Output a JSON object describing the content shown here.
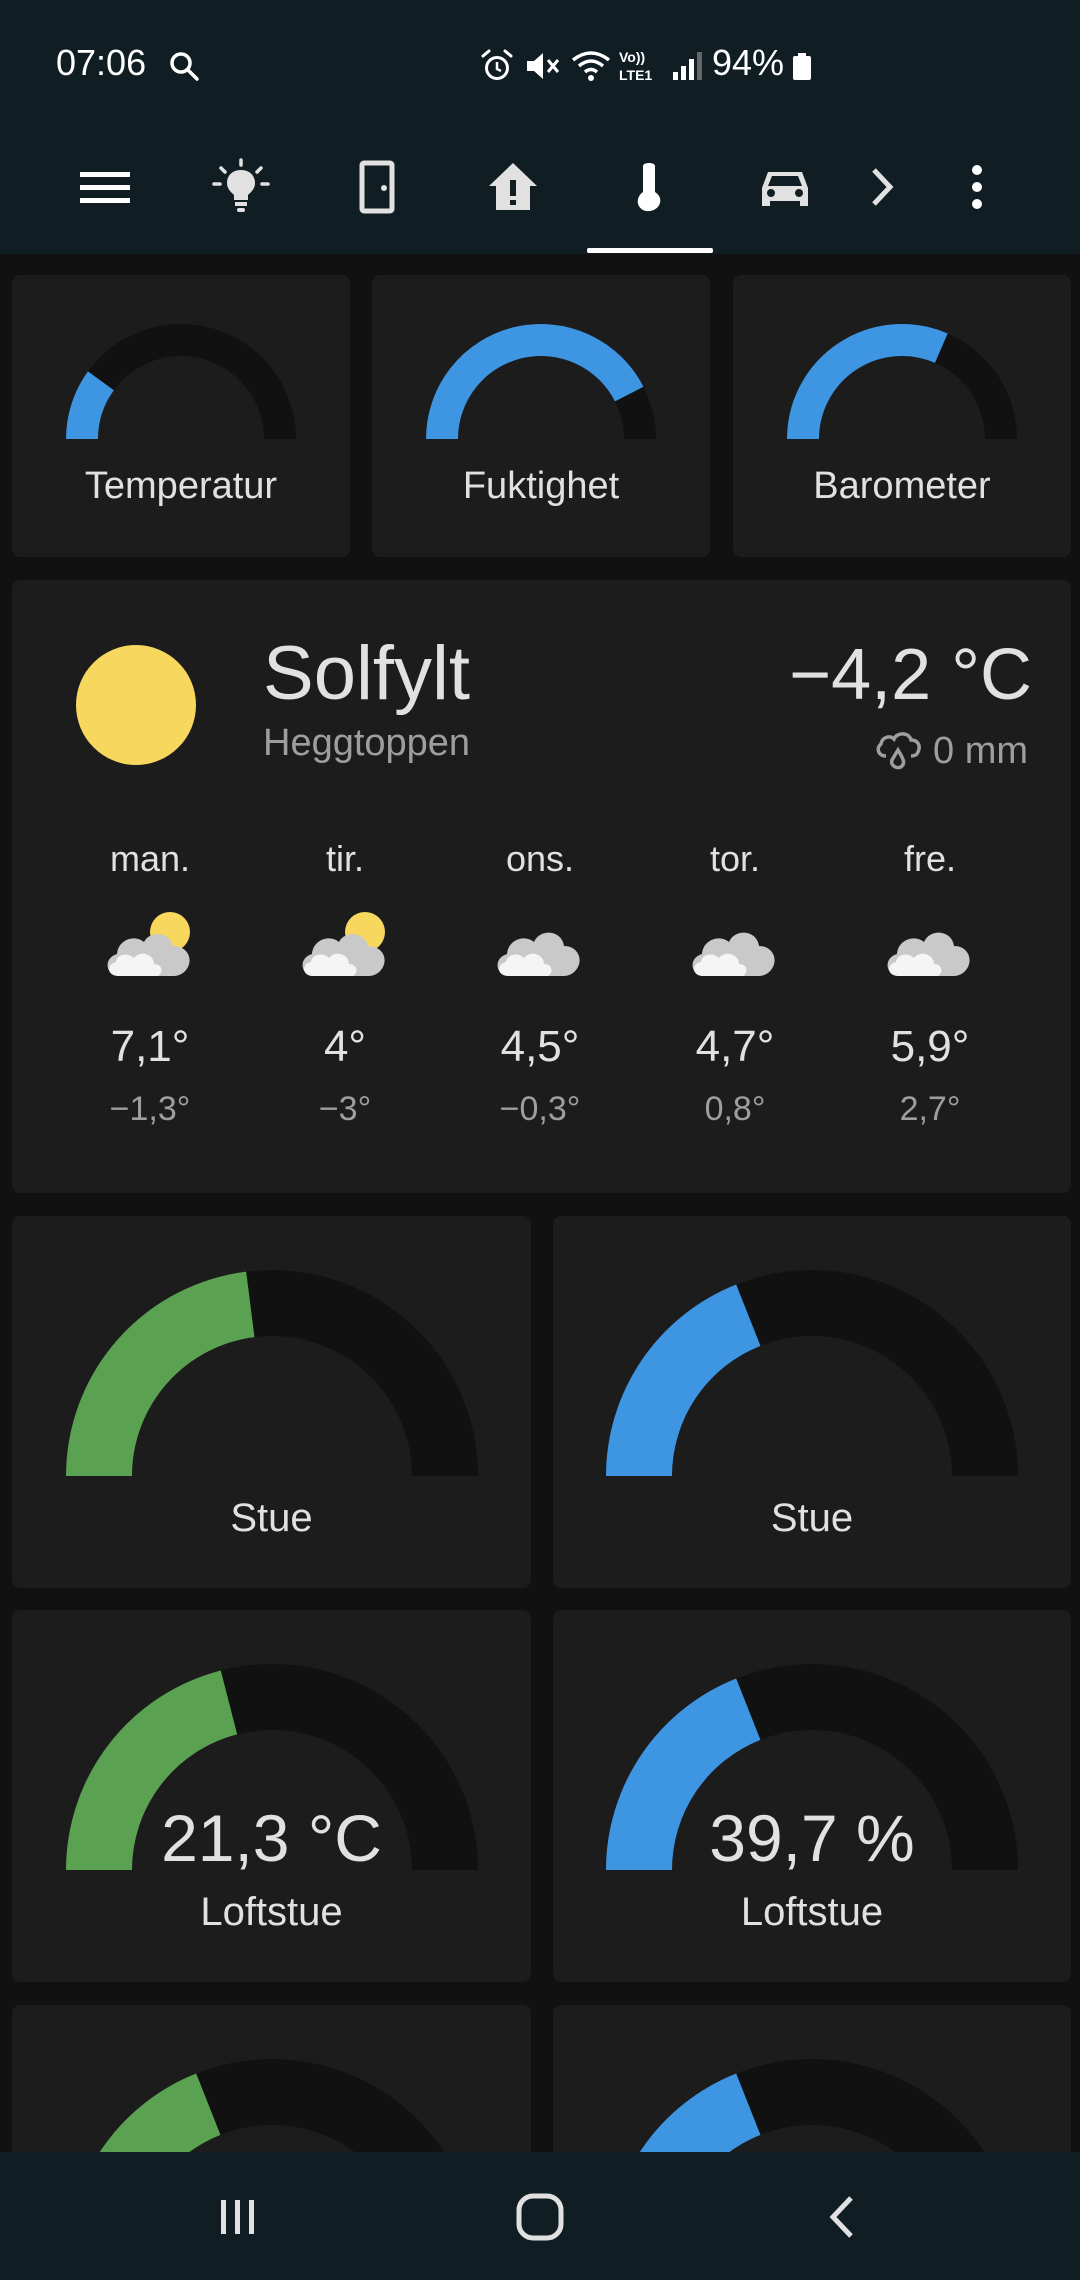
{
  "status_bar": {
    "time": "07:06",
    "battery": "94%",
    "icons": [
      "search-icon",
      "alarm-icon",
      "mute-icon",
      "wifi-calling-icon",
      "volte-icon",
      "signal-icon",
      "battery-icon"
    ]
  },
  "tabs": [
    {
      "name": "menu-icon"
    },
    {
      "name": "lightbulb-icon"
    },
    {
      "name": "door-icon"
    },
    {
      "name": "home-alert-icon"
    },
    {
      "name": "thermometer-icon",
      "active": true
    },
    {
      "name": "car-icon"
    },
    {
      "name": "chevron-right-icon"
    },
    {
      "name": "more-vertical-icon"
    }
  ],
  "colors": {
    "accent_blue": "#3e95e2",
    "green": "#5aa152",
    "track": "#111111",
    "card": "#1c1c1c",
    "sun": "#f7d75e"
  },
  "top_gauges": [
    {
      "title": "Temperatur",
      "fraction": 0.2,
      "color": "#3e95e2"
    },
    {
      "title": "Fuktighet",
      "fraction": 0.85,
      "color": "#3e95e2"
    },
    {
      "title": "Barometer",
      "fraction": 0.63,
      "color": "#3e95e2"
    }
  ],
  "weather": {
    "condition": "Solfylt",
    "location": "Heggtoppen",
    "temperature": "−4,2 °C",
    "precipitation": "0 mm",
    "forecast": [
      {
        "day": "man.",
        "high": "7,1°",
        "low": "−1,3°",
        "icon": "partly-cloudy-icon"
      },
      {
        "day": "tir.",
        "high": "4°",
        "low": "−3°",
        "icon": "partly-cloudy-icon"
      },
      {
        "day": "ons.",
        "high": "4,5°",
        "low": "−0,3°",
        "icon": "cloudy-icon"
      },
      {
        "day": "tor.",
        "high": "4,7°",
        "low": "0,8°",
        "icon": "cloudy-icon"
      },
      {
        "day": "fre.",
        "high": "5,9°",
        "low": "2,7°",
        "icon": "cloudy-icon"
      }
    ]
  },
  "room_gauges": [
    {
      "title": "Stue",
      "value": "",
      "fraction": 0.46,
      "color": "#5aa152"
    },
    {
      "title": "Stue",
      "value": "",
      "fraction": 0.38,
      "color": "#3e95e2"
    },
    {
      "title": "Loftstue",
      "value": "21,3 °C",
      "fraction": 0.42,
      "color": "#5aa152"
    },
    {
      "title": "Loftstue",
      "value": "39,7 %",
      "fraction": 0.38,
      "color": "#3e95e2"
    },
    {
      "title": "",
      "value": "",
      "fraction": 0.38,
      "color": "#5aa152"
    },
    {
      "title": "",
      "value": "",
      "fraction": 0.38,
      "color": "#3e95e2"
    }
  ],
  "nav_bar": [
    "recents-icon",
    "home-icon",
    "back-icon"
  ]
}
